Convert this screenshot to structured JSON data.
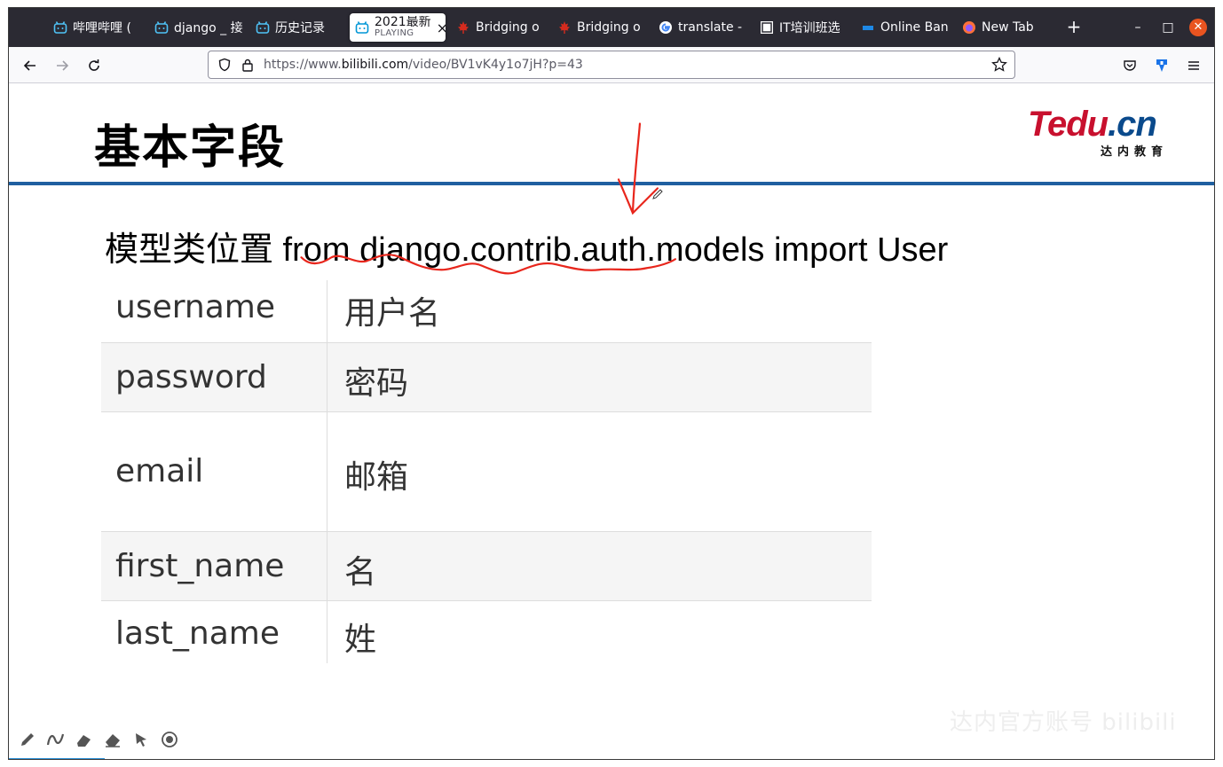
{
  "browser": {
    "tabs": [
      {
        "label": "哔哩哔哩 (",
        "icon": "bilibili-icon"
      },
      {
        "label": "django _ 接",
        "icon": "bilibili-icon"
      },
      {
        "label": "历史记录",
        "icon": "bilibili-icon"
      },
      {
        "label": "2021最新",
        "sublabel": "PLAYING",
        "icon": "bilibili-icon",
        "active": true
      },
      {
        "label": "Bridging o",
        "icon": "maple-leaf-icon"
      },
      {
        "label": "Bridging o",
        "icon": "maple-leaf-icon"
      },
      {
        "label": "translate -",
        "icon": "google-icon"
      },
      {
        "label": "IT培训班选",
        "icon": "site-icon"
      },
      {
        "label": "Online Ban",
        "icon": "site-icon"
      },
      {
        "label": "New Tab",
        "icon": "firefox-icon"
      }
    ],
    "url_prefix": "https://www.",
    "url_domain": "bilibili.com",
    "url_path": "/video/BV1vK4y1o7jH?p=43"
  },
  "slide": {
    "title": "基本字段",
    "logo_text": "Tedu",
    "logo_text_cn": ".cn",
    "logo_sub": "达内教育",
    "subheading": "模型类位置 from django.contrib.auth.models import User",
    "fields": [
      {
        "key": "username",
        "value": "用户名"
      },
      {
        "key": "password",
        "value": "密码"
      },
      {
        "key": "email",
        "value": "邮箱"
      },
      {
        "key": "first_name",
        "value": "名"
      },
      {
        "key": "last_name",
        "value": "姓"
      }
    ]
  },
  "player": {
    "watermark": "达内官方账号 bilibili"
  },
  "colors": {
    "rule": "#1f5fa0",
    "annotation": "#e8261c",
    "tab_strip": "#2b2a33"
  }
}
